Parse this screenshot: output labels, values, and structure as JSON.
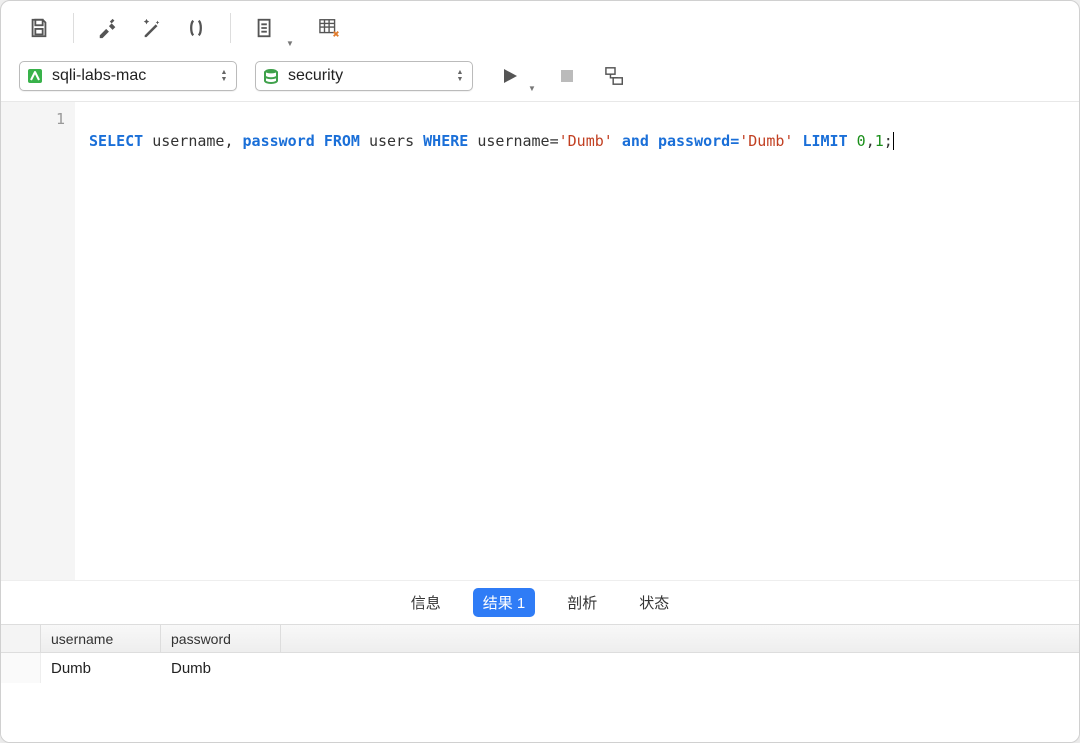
{
  "toolbarTop": {
    "icons": [
      "save",
      "hammer",
      "magic",
      "parens",
      "export",
      "execute-new"
    ]
  },
  "toolbarSecond": {
    "connection_dropdown": {
      "label": "sqli-labs-mac"
    },
    "database_dropdown": {
      "label": "security"
    }
  },
  "editor": {
    "gutter": [
      "1"
    ],
    "sql": {
      "select": "SELECT",
      "cols": "username, ",
      "password": "password",
      "from": "FROM",
      "table": "users",
      "where": "WHERE",
      "cond_left": "username=",
      "str1": "'Dumb'",
      "and": "and",
      "cond_left2": "password=",
      "str2": "'Dumb'",
      "limit": "LIMIT",
      "num1": "0",
      "comma": ",",
      "num2": "1",
      "semi": ";"
    }
  },
  "tabs": {
    "info": "信息",
    "result1": "结果 1",
    "profile": "剖析",
    "status": "状态"
  },
  "results": {
    "headers": [
      "username",
      "password"
    ],
    "rows": [
      [
        "Dumb",
        "Dumb"
      ]
    ]
  }
}
